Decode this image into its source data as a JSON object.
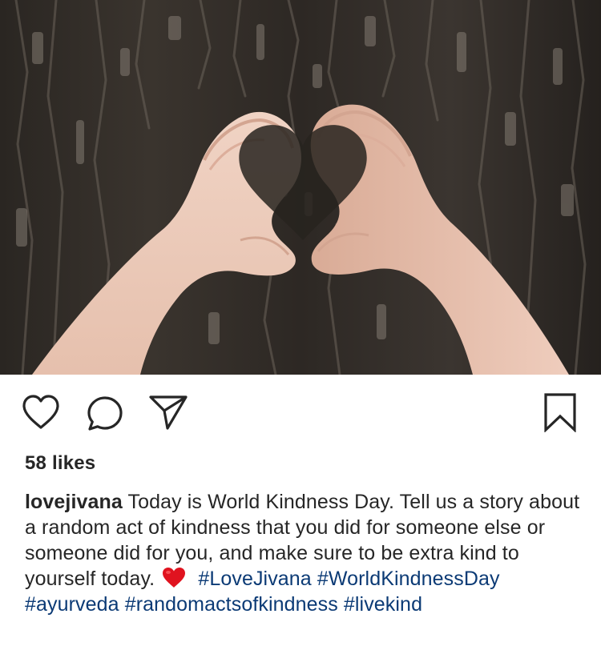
{
  "post": {
    "image_alt": "Two hands forming a heart shape against dark tree bark",
    "likes_text": "58 likes",
    "caption": {
      "username": "lovejivana",
      "text": "Today is World Kindness Day. Tell us a story about a random act of kindness that you did for someone else or someone did for you, and make sure to be extra kind to yourself today.",
      "emoji": "heart-emoji",
      "hashtags": [
        "#LoveJivana",
        "#WorldKindnessDay",
        "#ayurveda",
        "#randomactsofkindness",
        "#livekind"
      ]
    }
  },
  "icons": {
    "like": "heart-outline-icon",
    "comment": "comment-bubble-icon",
    "share": "paper-plane-icon",
    "save": "bookmark-icon"
  },
  "colors": {
    "text": "#262626",
    "hashtag": "#0b3a75",
    "heart_emoji": "#e0131f"
  }
}
